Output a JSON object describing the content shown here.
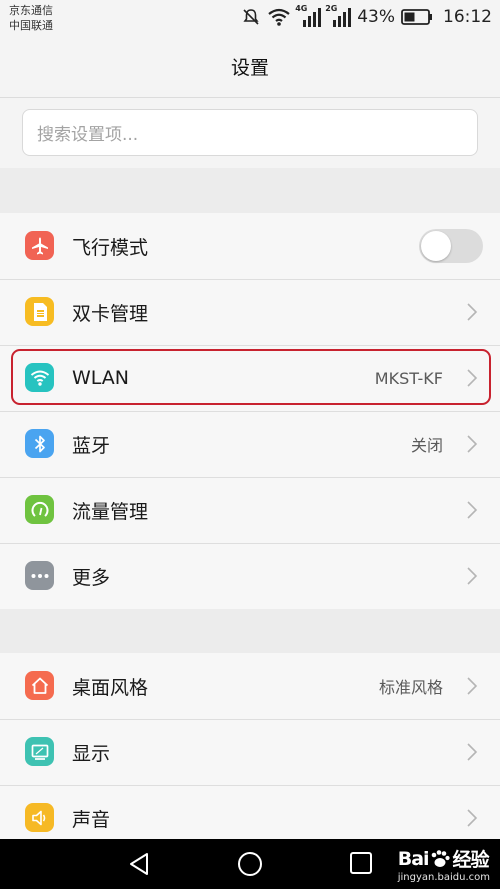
{
  "status_bar": {
    "carrier1": "京东通信",
    "carrier2": "中国联通",
    "net1": "4G",
    "net2": "2G",
    "battery": "43%",
    "time": "16:12"
  },
  "header": {
    "title": "设置"
  },
  "search": {
    "placeholder": "搜索设置项..."
  },
  "group1": {
    "items": [
      {
        "label": "飞行模式",
        "icon": "airplane-icon",
        "color": "#f16354",
        "toggle": "off"
      },
      {
        "label": "双卡管理",
        "icon": "sim-card-icon",
        "color": "#f7bc22"
      },
      {
        "label": "WLAN",
        "icon": "wifi-icon",
        "color": "#27c3c0",
        "value": "MKST-KF",
        "highlighted": true
      },
      {
        "label": "蓝牙",
        "icon": "bluetooth-icon",
        "color": "#4aa4f0",
        "value": "关闭"
      },
      {
        "label": "流量管理",
        "icon": "data-usage-icon",
        "color": "#6fc340"
      },
      {
        "label": "更多",
        "icon": "more-icon",
        "color": "#8f959c"
      }
    ]
  },
  "group2": {
    "items": [
      {
        "label": "桌面风格",
        "icon": "home-icon",
        "color": "#f56b4f",
        "value": "标准风格"
      },
      {
        "label": "显示",
        "icon": "display-icon",
        "color": "#3ec2b2"
      },
      {
        "label": "声音",
        "icon": "sound-icon",
        "color": "#f6b925"
      }
    ]
  },
  "watermark": {
    "brand": "Bai",
    "brand2": "经验",
    "url": "jingyan.baidu.com"
  },
  "colors": {
    "highlight": "#c8222f"
  }
}
